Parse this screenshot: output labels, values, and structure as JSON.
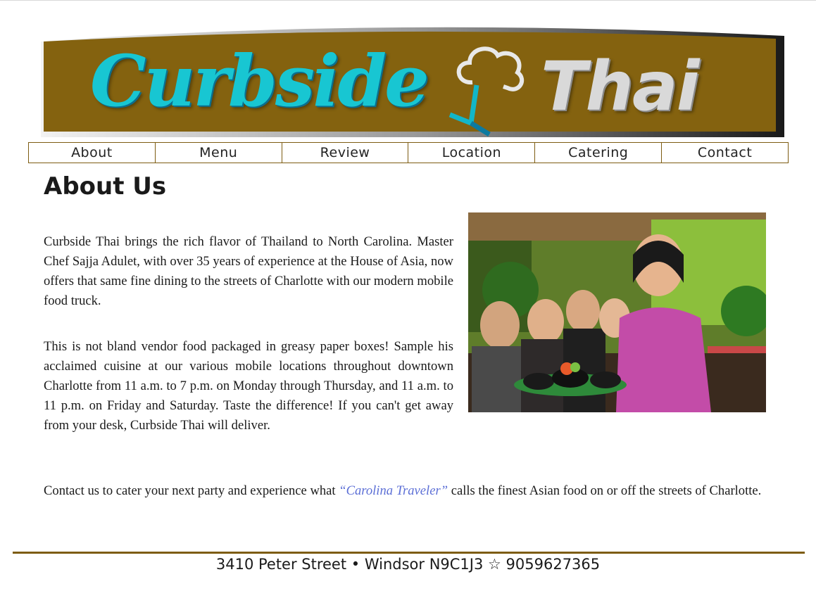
{
  "brand": {
    "name_script": "Curbside",
    "name_bold": "Thai",
    "colors": {
      "banner": "#84620f",
      "script": "#18c6d2",
      "accent": "#7d5c12"
    },
    "icon": "chef-hat-icon"
  },
  "nav": {
    "items": [
      {
        "label": "About"
      },
      {
        "label": "Menu"
      },
      {
        "label": "Review"
      },
      {
        "label": "Location"
      },
      {
        "label": "Catering"
      },
      {
        "label": "Contact"
      }
    ]
  },
  "main": {
    "title": "About Us",
    "paragraph1": "Curbside Thai brings the rich flavor of Thailand to North Carolina. Master Chef Sajja Adulet, with over 35 years of experience at the House of Asia, now offers that same fine dining to the streets of Charlotte with our modern mobile food truck.",
    "paragraph2": "This is not bland vendor food packaged in greasy paper boxes! Sample his acclaimed cuisine at our various mobile locations throughout downtown Charlotte from 11 a.m. to 7 p.m. on Monday through Thursday, and 11 a.m. to 11 p.m. on Friday and Saturday. Taste the difference! If you can't get away from your desk, Curbside Thai will deliver.",
    "paragraph3_before": "Contact us to cater your next party and experience what ",
    "paragraph3_link": "“Carolina Traveler”",
    "paragraph3_after": " calls the finest Asian food on or off the streets of Charlotte."
  },
  "footer": {
    "text": "3410 Peter Street • Windsor N9C1J3 ☆ 9059627365"
  }
}
